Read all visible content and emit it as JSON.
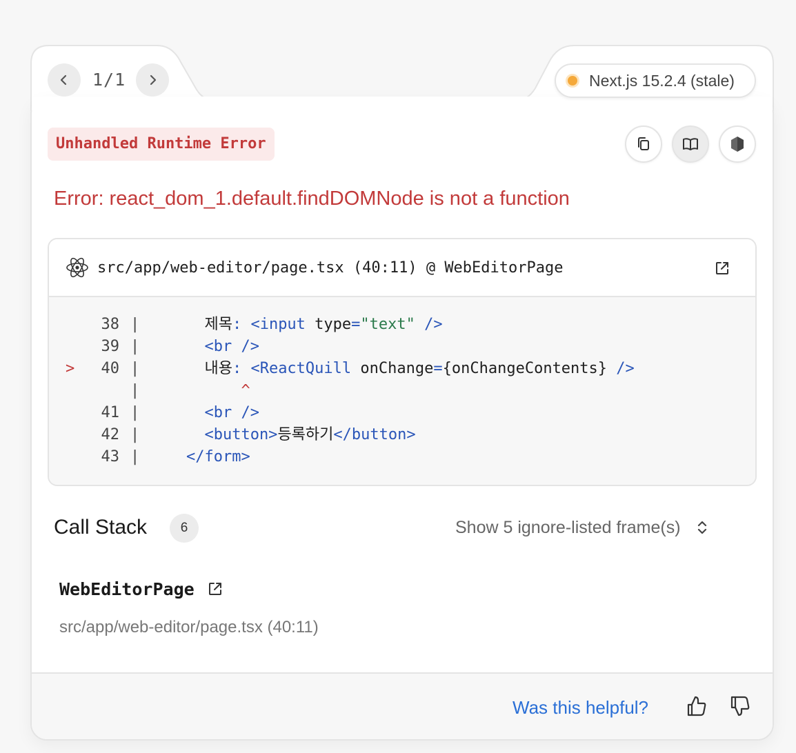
{
  "pager": {
    "label": "1/1"
  },
  "version": {
    "label": "Next.js 15.2.4 (stale)",
    "dot_color": "#f5a93a"
  },
  "error": {
    "badge": "Unhandled Runtime Error",
    "message": "Error: react_dom_1.default.findDOMNode is not a function"
  },
  "tools": [
    "copy-icon",
    "docs-book-icon",
    "nodejs-icon"
  ],
  "code_frame": {
    "path": "src/app/web-editor/page.tsx (40:11) @ WebEditorPage",
    "lines": [
      {
        "marker": "",
        "num": "38",
        "segments": [
          {
            "t": "      제목",
            "c": "plain"
          },
          {
            "t": ": ",
            "c": "tag"
          },
          {
            "t": "<input",
            "c": "tag"
          },
          {
            "t": " type",
            "c": "plain"
          },
          {
            "t": "=",
            "c": "tag"
          },
          {
            "t": "\"text\"",
            "c": "str"
          },
          {
            "t": " />",
            "c": "tag"
          }
        ]
      },
      {
        "marker": "",
        "num": "39",
        "segments": [
          {
            "t": "      <br />",
            "c": "tag"
          }
        ]
      },
      {
        "marker": ">",
        "num": "40",
        "segments": [
          {
            "t": "      내용",
            "c": "plain"
          },
          {
            "t": ": ",
            "c": "tag"
          },
          {
            "t": "<ReactQuill",
            "c": "tag"
          },
          {
            "t": " onChange",
            "c": "plain"
          },
          {
            "t": "=",
            "c": "tag"
          },
          {
            "t": "{onChangeContents}",
            "c": "plain"
          },
          {
            "t": " />",
            "c": "tag"
          }
        ]
      },
      {
        "marker": "",
        "num": "",
        "segments": [
          {
            "t": "          ^",
            "c": "red"
          }
        ]
      },
      {
        "marker": "",
        "num": "41",
        "segments": [
          {
            "t": "      <br />",
            "c": "tag"
          }
        ]
      },
      {
        "marker": "",
        "num": "42",
        "segments": [
          {
            "t": "      <button>",
            "c": "tag"
          },
          {
            "t": "등록하기",
            "c": "plain"
          },
          {
            "t": "</button>",
            "c": "tag"
          }
        ]
      },
      {
        "marker": "",
        "num": "43",
        "segments": [
          {
            "t": "    </form>",
            "c": "tag"
          }
        ]
      }
    ]
  },
  "call_stack": {
    "title": "Call Stack",
    "count": "6",
    "ignore_toggle": "Show 5 ignore-listed frame(s)",
    "frames": [
      {
        "name": "WebEditorPage",
        "location": "src/app/web-editor/page.tsx (40:11)"
      }
    ]
  },
  "footer": {
    "helpful": "Was this helpful?"
  }
}
